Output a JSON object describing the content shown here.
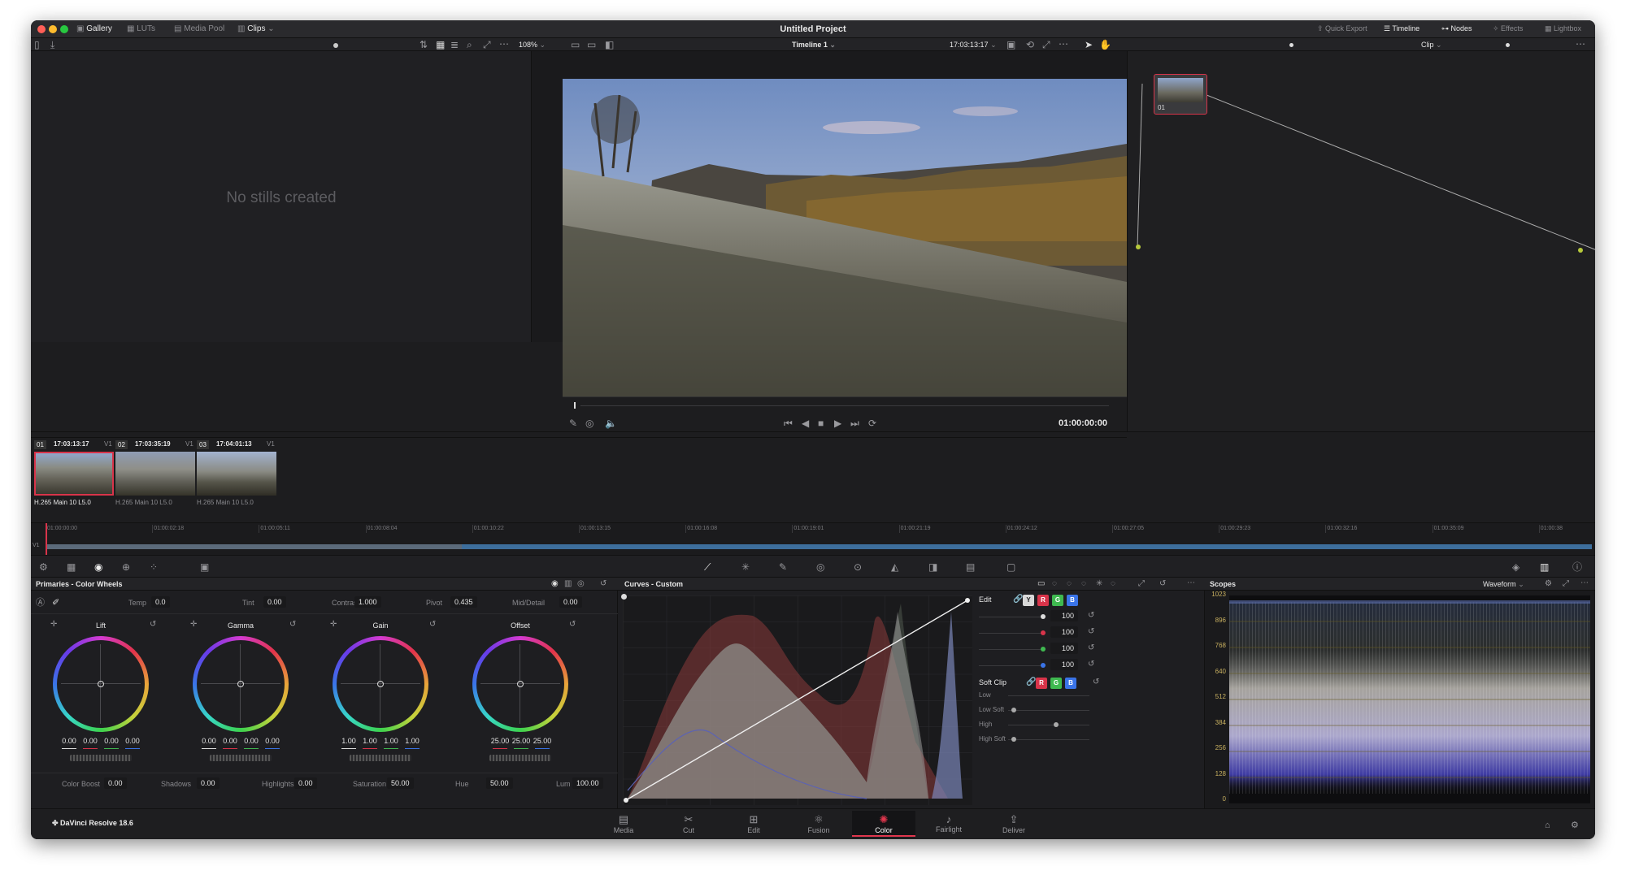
{
  "window_title": "Untitled Project",
  "topbar_left": [
    {
      "label": "Gallery",
      "icon": "gallery-icon"
    },
    {
      "label": "LUTs",
      "icon": "luts-icon"
    },
    {
      "label": "Media Pool",
      "icon": "media-pool-icon"
    },
    {
      "label": "Clips",
      "icon": "clips-icon"
    }
  ],
  "topbar_right": [
    {
      "label": "Quick Export",
      "icon": "export-icon"
    },
    {
      "label": "Timeline",
      "icon": "timeline-icon"
    },
    {
      "label": "Nodes",
      "icon": "nodes-icon"
    },
    {
      "label": "Effects",
      "icon": "effects-icon"
    },
    {
      "label": "Lightbox",
      "icon": "lightbox-icon"
    }
  ],
  "viewer": {
    "zoom": "108%",
    "timeline_name": "Timeline 1",
    "source_timecode": "17:03:13:17",
    "timecode": "01:00:00:00"
  },
  "gallery": {
    "empty_text": "No stills created"
  },
  "node_panel": {
    "mode": "Clip",
    "node_label": "01"
  },
  "clips": [
    {
      "index": "01",
      "timecode": "17:03:13:17",
      "track": "V1",
      "codec": "H.265 Main 10 L5.0",
      "selected": true
    },
    {
      "index": "02",
      "timecode": "17:03:35:19",
      "track": "V1",
      "codec": "H.265 Main 10 L5.0",
      "selected": false
    },
    {
      "index": "03",
      "timecode": "17:04:01:13",
      "track": "V1",
      "codec": "H.265 Main 10 L5.0",
      "selected": false
    }
  ],
  "ruler": {
    "track": "V1",
    "ticks": [
      "01:00:00:00",
      "01:00:02:18",
      "01:00:05:11",
      "01:00:08:04",
      "01:00:10:22",
      "01:00:13:15",
      "01:00:16:08",
      "01:00:19:01",
      "01:00:21:19",
      "01:00:24:12",
      "01:00:27:05",
      "01:00:29:23",
      "01:00:32:16",
      "01:00:35:09",
      "01:00:38"
    ]
  },
  "primaries": {
    "title": "Primaries - Color Wheels",
    "top": [
      {
        "label": "Temp",
        "value": "0.0"
      },
      {
        "label": "Tint",
        "value": "0.00"
      },
      {
        "label": "Contrast",
        "value": "1.000"
      },
      {
        "label": "Pivot",
        "value": "0.435"
      },
      {
        "label": "Mid/Detail",
        "value": "0.00"
      }
    ],
    "wheels": [
      {
        "name": "Lift",
        "values": [
          "0.00",
          "0.00",
          "0.00",
          "0.00"
        ]
      },
      {
        "name": "Gamma",
        "values": [
          "0.00",
          "0.00",
          "0.00",
          "0.00"
        ]
      },
      {
        "name": "Gain",
        "values": [
          "1.00",
          "1.00",
          "1.00",
          "1.00"
        ]
      },
      {
        "name": "Offset",
        "values": [
          "25.00",
          "25.00",
          "25.00"
        ]
      }
    ],
    "bottom": [
      {
        "label": "Color Boost",
        "value": "0.00"
      },
      {
        "label": "Shadows",
        "value": "0.00"
      },
      {
        "label": "Highlights",
        "value": "0.00"
      },
      {
        "label": "Saturation",
        "value": "50.00"
      },
      {
        "label": "Hue",
        "value": "50.00"
      },
      {
        "label": "Lum Mix",
        "value": "100.00"
      }
    ]
  },
  "curves": {
    "title": "Curves - Custom",
    "edit_label": "Edit",
    "channels": [
      "Y",
      "R",
      "G",
      "B"
    ],
    "edit_values": [
      "100",
      "100",
      "100",
      "100"
    ],
    "soft_clip": {
      "label": "Soft Clip",
      "rows": [
        "Low",
        "Low Soft",
        "High",
        "High Soft"
      ]
    }
  },
  "scopes": {
    "title": "Scopes",
    "mode": "Waveform",
    "scale": [
      "1023",
      "896",
      "768",
      "640",
      "512",
      "384",
      "256",
      "128",
      "0"
    ]
  },
  "pages": [
    {
      "label": "Media",
      "icon": "media-page-icon"
    },
    {
      "label": "Cut",
      "icon": "cut-page-icon"
    },
    {
      "label": "Edit",
      "icon": "edit-page-icon"
    },
    {
      "label": "Fusion",
      "icon": "fusion-page-icon"
    },
    {
      "label": "Color",
      "icon": "color-page-icon",
      "active": true
    },
    {
      "label": "Fairlight",
      "icon": "fairlight-page-icon"
    },
    {
      "label": "Deliver",
      "icon": "deliver-page-icon"
    }
  ],
  "app_name": "DaVinci Resolve 18.6",
  "colors": {
    "accent": "#d8344a",
    "active_red": "#e0364d",
    "timeline_blue": "#3d6e9c"
  }
}
